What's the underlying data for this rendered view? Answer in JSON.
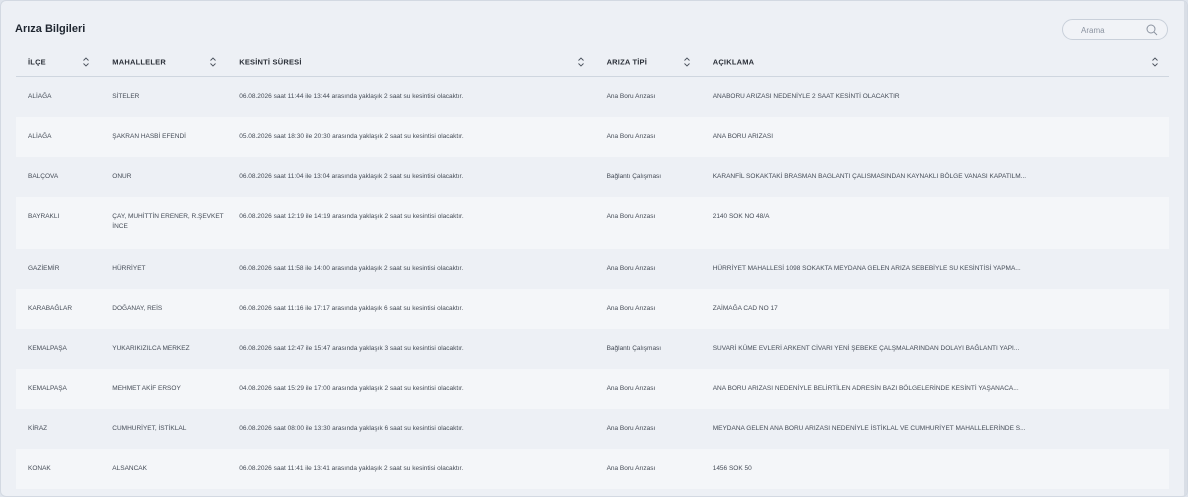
{
  "panel": {
    "title": "Arıza Bilgileri"
  },
  "search": {
    "placeholder": "Arama"
  },
  "table": {
    "headers": [
      "İLÇE",
      "MAHALLELER",
      "KESİNTİ SÜRESİ",
      "ARIZA TİPİ",
      "AÇIKLAMA"
    ],
    "rows": [
      [
        "ALİAĞA",
        "SİTELER",
        "06.08.2026 saat 11:44 ile 13:44 arasında yaklaşık 2 saat su kesintisi olacaktır.",
        "Ana Boru Arızası",
        "ANABORU ARIZASI NEDENİYLE 2 SAAT KESİNTİ OLACAKTIR"
      ],
      [
        "ALİAĞA",
        "ŞAKRAN HASBİ EFENDİ",
        "05.08.2026 saat 18:30 ile 20:30 arasında yaklaşık 2 saat su kesintisi olacaktır.",
        "Ana Boru Arızası",
        "ANA BORU ARIZASI"
      ],
      [
        "BALÇOVA",
        "ONUR",
        "06.08.2026 saat 11:04 ile 13:04 arasında yaklaşık 2 saat su kesintisi olacaktır.",
        "Bağlantı Çalışması",
        "KARANFİL SOKAKTAKİ BRASMAN BAGLANTI ÇALISMASINDAN KAYNAKLI BÖLGE VANASI KAPATILM..."
      ],
      [
        "BAYRAKLI",
        "ÇAY, MUHİTTİN ERENER, R.ŞEVKET İNCE",
        "06.08.2026 saat 12:19 ile 14:19 arasında yaklaşık 2 saat su kesintisi olacaktır.",
        "Ana Boru Arızası",
        "2140 SOK NO 48/A"
      ],
      [
        "GAZİEMİR",
        "HÜRRİYET",
        "06.08.2026 saat 11:58 ile 14:00 arasında yaklaşık 2 saat su kesintisi olacaktır.",
        "Ana Boru Arızası",
        "HÜRRİYET MAHALLESİ 1098 SOKAKTA MEYDANA GELEN ARIZA SEBEBİYLE SU KESİNTİSİ YAPMA..."
      ],
      [
        "KARABAĞLAR",
        "DOĞANAY, REİS",
        "06.08.2026 saat 11:16 ile 17:17 arasında yaklaşık 6 saat su kesintisi olacaktır.",
        "Ana Boru Arızası",
        "ZAİMAĞA CAD NO 17"
      ],
      [
        "KEMALPAŞA",
        "YUKARIKIZILCA MERKEZ",
        "06.08.2026 saat 12:47 ile 15:47 arasında yaklaşık 3 saat su kesintisi olacaktır.",
        "Bağlantı Çalışması",
        "SUVARİ KÜME EVLERİ ARKENT CİVARI YENİ ŞEBEKE ÇALŞMALARINDAN DOLAYI BAĞLANTI YAPI..."
      ],
      [
        "KEMALPAŞA",
        "MEHMET AKİF ERSOY",
        "04.08.2026 saat 15:29 ile 17:00 arasında yaklaşık 2 saat su kesintisi olacaktır.",
        "Ana Boru Arızası",
        "ANA BORU ARIZASI NEDENİYLE BELİRTİLEN ADRESİN BAZI BÖLGELERİNDE KESİNTİ YAŞANACA..."
      ],
      [
        "KİRAZ",
        "CUMHURİYET, İSTİKLAL",
        "06.08.2026 saat 08:00 ile 13:30 arasında yaklaşık 6 saat su kesintisi olacaktır.",
        "Ana Boru Arızası",
        "MEYDANA GELEN ANA BORU ARIZASI NEDENİYLE İSTİKLAL VE CUMHURİYET MAHALLELERİNDE S..."
      ],
      [
        "KONAK",
        "ALSANCAK",
        "06.08.2026 saat 11:41 ile 13:41 arasında yaklaşık 2 saat su kesintisi olacaktır.",
        "Ana Boru Arızası",
        "1456 SOK 50"
      ]
    ]
  }
}
